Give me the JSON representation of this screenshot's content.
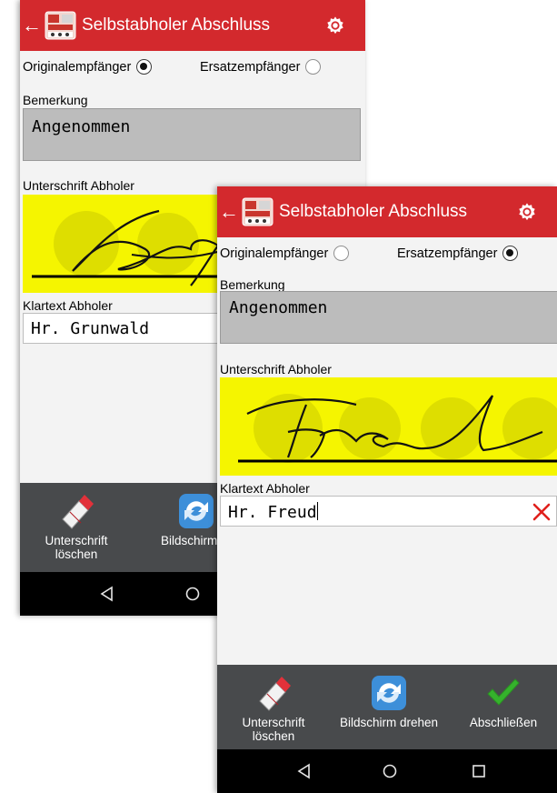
{
  "back_screen": {
    "title": "Selbstabholer Abschluss",
    "back_glyph": "←",
    "recipient": {
      "original_label": "Originalempfänger",
      "original_selected": true,
      "substitute_label": "Ersatzempfänger",
      "substitute_selected": false
    },
    "remark_label": "Bemerkung",
    "remark_value": "Angenommen",
    "signature_label": "Unterschrift Abholer",
    "cleartext_label": "Klartext Abholer",
    "cleartext_value": "Hr. Grunwald",
    "actions": [
      {
        "line1": "Unterschrift",
        "line2": "löschen",
        "icon": "eraser-icon"
      },
      {
        "line1": "Bildschirm dr",
        "icon": "rotate-icon"
      }
    ]
  },
  "front_screen": {
    "title": "Selbstabholer Abschluss",
    "back_glyph": "←",
    "recipient": {
      "original_label": "Originalempfänger",
      "original_selected": false,
      "substitute_label": "Ersatzempfänger",
      "substitute_selected": true
    },
    "remark_label": "Bemerkung",
    "remark_value": "Angenommen",
    "signature_label": "Unterschrift Abholer",
    "cleartext_label": "Klartext Abholer",
    "cleartext_value": "Hr. Freud",
    "actions": [
      {
        "line1": "Unterschrift",
        "line2": "löschen",
        "icon": "eraser-icon"
      },
      {
        "line1": "Bildschirm drehen",
        "icon": "rotate-icon"
      },
      {
        "line1": "Abschließen",
        "icon": "checkmark-icon"
      }
    ]
  },
  "colors": {
    "app_bar": "#d3292d",
    "signature_pad": "#f5f500",
    "remark_box": "#bcbcbc",
    "bottom_bar": "#484a4c",
    "clear_x": "#e0201c"
  }
}
